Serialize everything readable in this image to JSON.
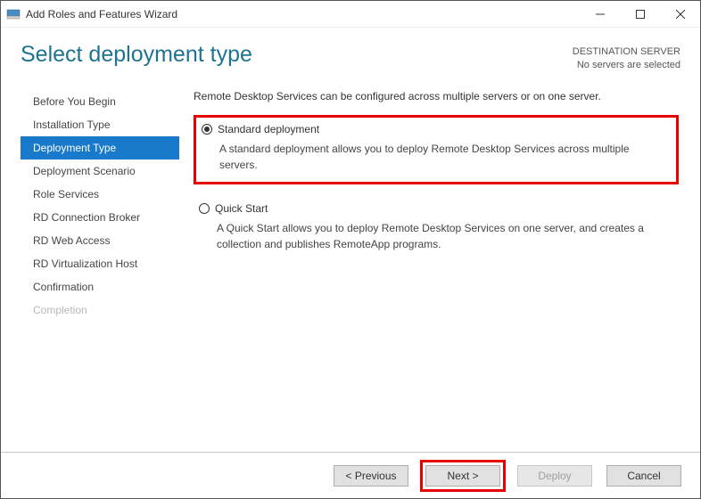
{
  "window": {
    "title": "Add Roles and Features Wizard"
  },
  "header": {
    "page_title": "Select deployment type",
    "server_label": "DESTINATION SERVER",
    "server_status": "No servers are selected"
  },
  "sidebar": {
    "steps": [
      {
        "label": "Before You Begin",
        "state": "normal"
      },
      {
        "label": "Installation Type",
        "state": "normal"
      },
      {
        "label": "Deployment Type",
        "state": "active"
      },
      {
        "label": "Deployment Scenario",
        "state": "normal"
      },
      {
        "label": "Role Services",
        "state": "normal"
      },
      {
        "label": "RD Connection Broker",
        "state": "normal"
      },
      {
        "label": "RD Web Access",
        "state": "normal"
      },
      {
        "label": "RD Virtualization Host",
        "state": "normal"
      },
      {
        "label": "Confirmation",
        "state": "normal"
      },
      {
        "label": "Completion",
        "state": "disabled"
      }
    ]
  },
  "main": {
    "intro": "Remote Desktop Services can be configured across multiple servers or on one server.",
    "options": [
      {
        "label": "Standard deployment",
        "selected": true,
        "highlighted": true,
        "description": "A standard deployment allows you to deploy Remote Desktop Services across multiple servers."
      },
      {
        "label": "Quick Start",
        "selected": false,
        "highlighted": false,
        "description": "A Quick Start allows you to deploy Remote Desktop Services on one server, and creates a collection and publishes RemoteApp programs."
      }
    ]
  },
  "footer": {
    "previous": "< Previous",
    "next": "Next >",
    "deploy": "Deploy",
    "cancel": "Cancel",
    "next_highlighted": true,
    "deploy_disabled": true
  }
}
